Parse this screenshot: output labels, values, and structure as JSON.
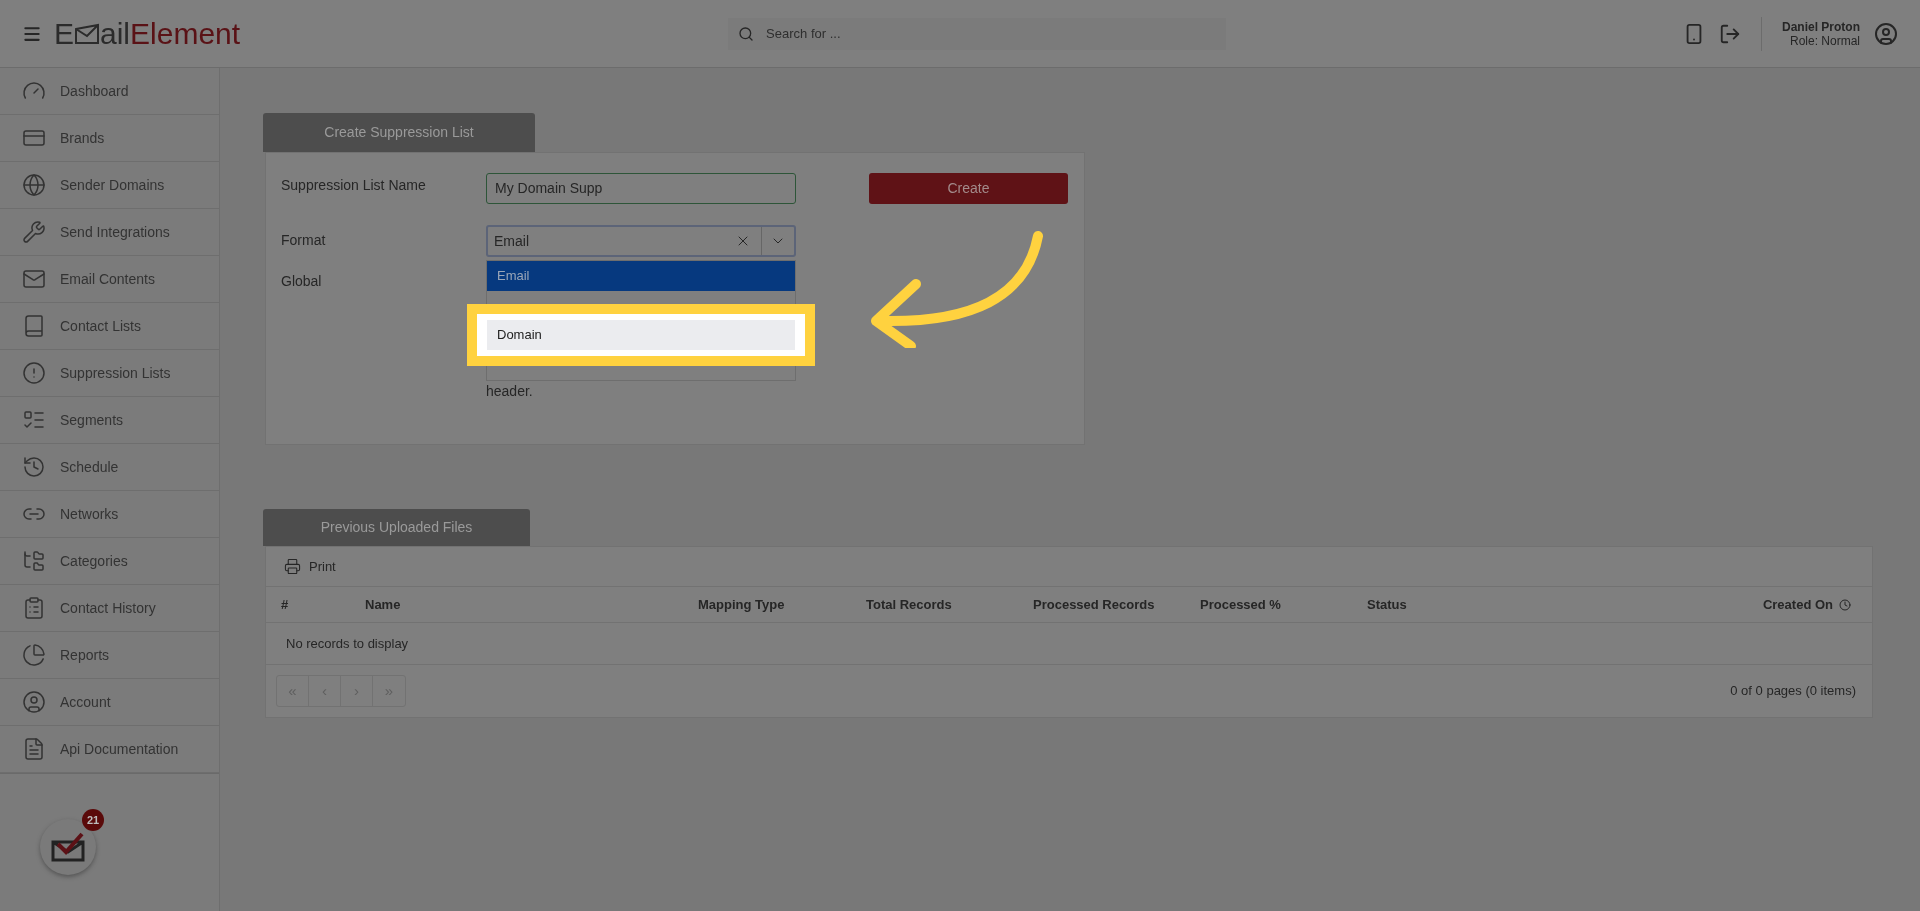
{
  "header": {
    "logo": {
      "first": "E",
      "second": "ail",
      "third": "Element"
    },
    "search": {
      "placeholder": "Search for ..."
    },
    "user": {
      "name": "Daniel Proton",
      "role": "Role: Normal"
    }
  },
  "sidebar": {
    "items": [
      {
        "label": "Dashboard"
      },
      {
        "label": "Brands"
      },
      {
        "label": "Sender Domains"
      },
      {
        "label": "Send Integrations"
      },
      {
        "label": "Email Contents"
      },
      {
        "label": "Contact Lists"
      },
      {
        "label": "Suppression Lists"
      },
      {
        "label": "Segments"
      },
      {
        "label": "Schedule"
      },
      {
        "label": "Networks"
      },
      {
        "label": "Categories"
      },
      {
        "label": "Contact History"
      },
      {
        "label": "Reports"
      },
      {
        "label": "Account"
      },
      {
        "label": "Api Documentation"
      }
    ],
    "badge": "21"
  },
  "create_form": {
    "tab": "Create Suppression List",
    "name_label": "Suppression List Name",
    "name_value": "My Domain Supp",
    "format_label": "Format",
    "format_value": "Email",
    "global_label": "Global",
    "create_button": "Create",
    "format_options": [
      {
        "label": "Email",
        "selected": true,
        "highlighted": false
      },
      {
        "label": "Domain",
        "selected": false,
        "highlighted": true
      }
    ],
    "help_text": "header."
  },
  "files": {
    "tab": "Previous Uploaded Files",
    "print": "Print",
    "table": {
      "columns": [
        "#",
        "Name",
        "Mapping Type",
        "Total Records",
        "Processed Records",
        "Processed %",
        "Status",
        "Created On"
      ],
      "empty": "No records to display"
    },
    "pager": {
      "buttons": [
        "«",
        "‹",
        "›",
        "»"
      ],
      "info": "0 of 0 pages (0 items)"
    }
  }
}
